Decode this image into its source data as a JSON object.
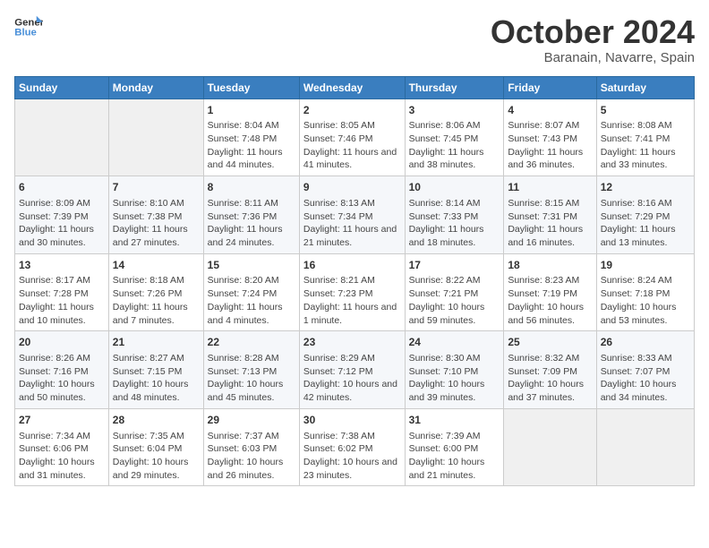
{
  "header": {
    "logo_line1": "General",
    "logo_line2": "Blue",
    "month": "October 2024",
    "location": "Baranain, Navarre, Spain"
  },
  "weekdays": [
    "Sunday",
    "Monday",
    "Tuesday",
    "Wednesday",
    "Thursday",
    "Friday",
    "Saturday"
  ],
  "weeks": [
    [
      {
        "day": "",
        "content": ""
      },
      {
        "day": "",
        "content": ""
      },
      {
        "day": "1",
        "content": "Sunrise: 8:04 AM\nSunset: 7:48 PM\nDaylight: 11 hours and 44 minutes."
      },
      {
        "day": "2",
        "content": "Sunrise: 8:05 AM\nSunset: 7:46 PM\nDaylight: 11 hours and 41 minutes."
      },
      {
        "day": "3",
        "content": "Sunrise: 8:06 AM\nSunset: 7:45 PM\nDaylight: 11 hours and 38 minutes."
      },
      {
        "day": "4",
        "content": "Sunrise: 8:07 AM\nSunset: 7:43 PM\nDaylight: 11 hours and 36 minutes."
      },
      {
        "day": "5",
        "content": "Sunrise: 8:08 AM\nSunset: 7:41 PM\nDaylight: 11 hours and 33 minutes."
      }
    ],
    [
      {
        "day": "6",
        "content": "Sunrise: 8:09 AM\nSunset: 7:39 PM\nDaylight: 11 hours and 30 minutes."
      },
      {
        "day": "7",
        "content": "Sunrise: 8:10 AM\nSunset: 7:38 PM\nDaylight: 11 hours and 27 minutes."
      },
      {
        "day": "8",
        "content": "Sunrise: 8:11 AM\nSunset: 7:36 PM\nDaylight: 11 hours and 24 minutes."
      },
      {
        "day": "9",
        "content": "Sunrise: 8:13 AM\nSunset: 7:34 PM\nDaylight: 11 hours and 21 minutes."
      },
      {
        "day": "10",
        "content": "Sunrise: 8:14 AM\nSunset: 7:33 PM\nDaylight: 11 hours and 18 minutes."
      },
      {
        "day": "11",
        "content": "Sunrise: 8:15 AM\nSunset: 7:31 PM\nDaylight: 11 hours and 16 minutes."
      },
      {
        "day": "12",
        "content": "Sunrise: 8:16 AM\nSunset: 7:29 PM\nDaylight: 11 hours and 13 minutes."
      }
    ],
    [
      {
        "day": "13",
        "content": "Sunrise: 8:17 AM\nSunset: 7:28 PM\nDaylight: 11 hours and 10 minutes."
      },
      {
        "day": "14",
        "content": "Sunrise: 8:18 AM\nSunset: 7:26 PM\nDaylight: 11 hours and 7 minutes."
      },
      {
        "day": "15",
        "content": "Sunrise: 8:20 AM\nSunset: 7:24 PM\nDaylight: 11 hours and 4 minutes."
      },
      {
        "day": "16",
        "content": "Sunrise: 8:21 AM\nSunset: 7:23 PM\nDaylight: 11 hours and 1 minute."
      },
      {
        "day": "17",
        "content": "Sunrise: 8:22 AM\nSunset: 7:21 PM\nDaylight: 10 hours and 59 minutes."
      },
      {
        "day": "18",
        "content": "Sunrise: 8:23 AM\nSunset: 7:19 PM\nDaylight: 10 hours and 56 minutes."
      },
      {
        "day": "19",
        "content": "Sunrise: 8:24 AM\nSunset: 7:18 PM\nDaylight: 10 hours and 53 minutes."
      }
    ],
    [
      {
        "day": "20",
        "content": "Sunrise: 8:26 AM\nSunset: 7:16 PM\nDaylight: 10 hours and 50 minutes."
      },
      {
        "day": "21",
        "content": "Sunrise: 8:27 AM\nSunset: 7:15 PM\nDaylight: 10 hours and 48 minutes."
      },
      {
        "day": "22",
        "content": "Sunrise: 8:28 AM\nSunset: 7:13 PM\nDaylight: 10 hours and 45 minutes."
      },
      {
        "day": "23",
        "content": "Sunrise: 8:29 AM\nSunset: 7:12 PM\nDaylight: 10 hours and 42 minutes."
      },
      {
        "day": "24",
        "content": "Sunrise: 8:30 AM\nSunset: 7:10 PM\nDaylight: 10 hours and 39 minutes."
      },
      {
        "day": "25",
        "content": "Sunrise: 8:32 AM\nSunset: 7:09 PM\nDaylight: 10 hours and 37 minutes."
      },
      {
        "day": "26",
        "content": "Sunrise: 8:33 AM\nSunset: 7:07 PM\nDaylight: 10 hours and 34 minutes."
      }
    ],
    [
      {
        "day": "27",
        "content": "Sunrise: 7:34 AM\nSunset: 6:06 PM\nDaylight: 10 hours and 31 minutes."
      },
      {
        "day": "28",
        "content": "Sunrise: 7:35 AM\nSunset: 6:04 PM\nDaylight: 10 hours and 29 minutes."
      },
      {
        "day": "29",
        "content": "Sunrise: 7:37 AM\nSunset: 6:03 PM\nDaylight: 10 hours and 26 minutes."
      },
      {
        "day": "30",
        "content": "Sunrise: 7:38 AM\nSunset: 6:02 PM\nDaylight: 10 hours and 23 minutes."
      },
      {
        "day": "31",
        "content": "Sunrise: 7:39 AM\nSunset: 6:00 PM\nDaylight: 10 hours and 21 minutes."
      },
      {
        "day": "",
        "content": ""
      },
      {
        "day": "",
        "content": ""
      }
    ]
  ]
}
